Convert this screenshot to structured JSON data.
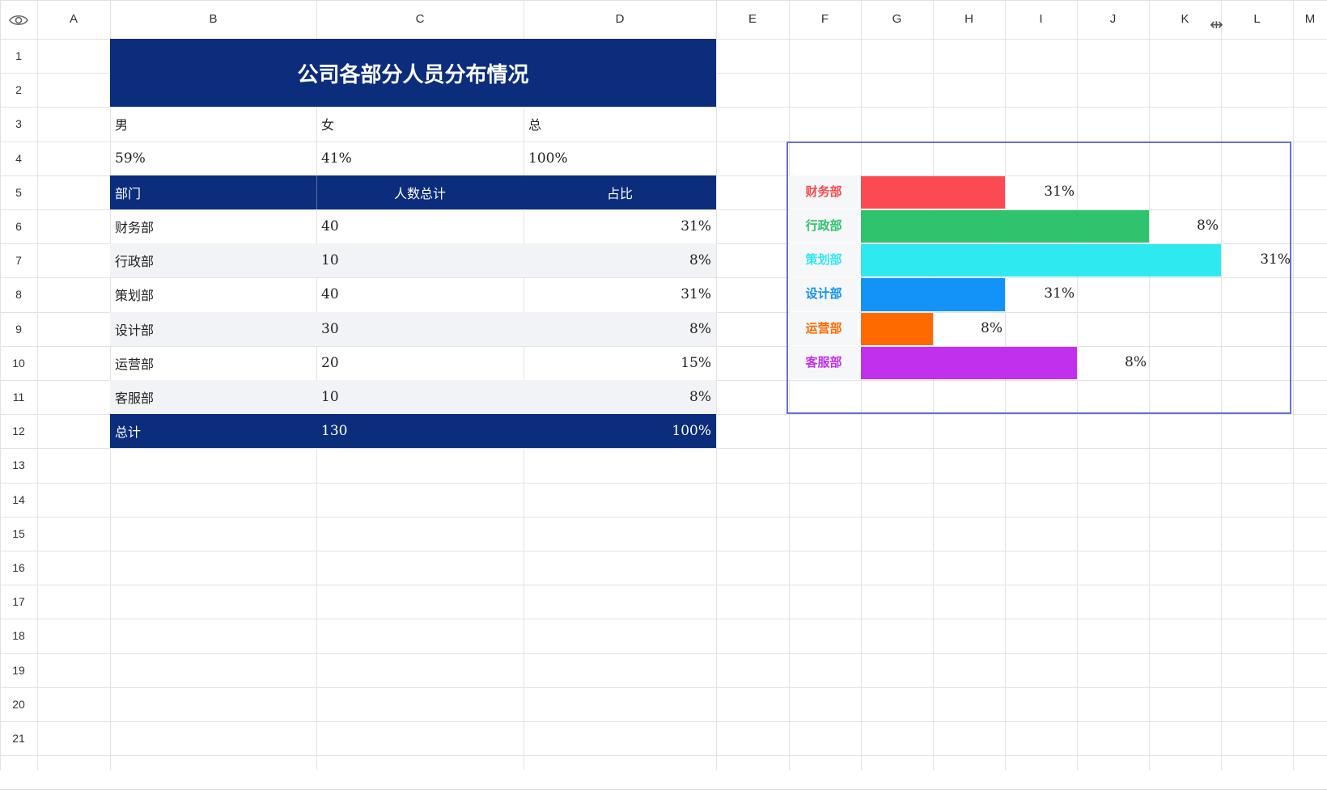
{
  "columns": [
    "A",
    "B",
    "C",
    "D",
    "E",
    "F",
    "G",
    "H",
    "I",
    "J",
    "K",
    "L",
    "M"
  ],
  "rows": [
    "1",
    "2",
    "3",
    "4",
    "5",
    "6",
    "7",
    "8",
    "9",
    "10",
    "11",
    "12",
    "13",
    "14",
    "15",
    "16",
    "17",
    "18",
    "19",
    "20",
    "21"
  ],
  "title": "公司各部分人员分布情况",
  "gender": {
    "labels": [
      "男",
      "女",
      "总"
    ],
    "values": [
      "59%",
      "41%",
      "100%"
    ]
  },
  "table": {
    "headers": [
      "部门",
      "人数总计",
      "占比"
    ],
    "rows": [
      {
        "dept": "财务部",
        "count": "40",
        "pct": "31%"
      },
      {
        "dept": "行政部",
        "count": "10",
        "pct": "8%"
      },
      {
        "dept": "策划部",
        "count": "40",
        "pct": "31%"
      },
      {
        "dept": "设计部",
        "count": "30",
        "pct": "8%"
      },
      {
        "dept": "运营部",
        "count": "20",
        "pct": "15%"
      },
      {
        "dept": "客服部",
        "count": "10",
        "pct": "8%"
      }
    ],
    "total": {
      "label": "总计",
      "count": "130",
      "pct": "100%"
    }
  },
  "chart_data": {
    "type": "bar",
    "orientation": "horizontal",
    "categories": [
      "财务部",
      "行政部",
      "策划部",
      "设计部",
      "运营部",
      "客服部"
    ],
    "values": [
      40,
      80,
      100,
      40,
      20,
      60
    ],
    "value_labels": [
      "31%",
      "8%",
      "31%",
      "31%",
      "8%",
      "8%"
    ],
    "colors": [
      "#fb4a52",
      "#2fc36d",
      "#2eeaf0",
      "#1392f8",
      "#ff6a00",
      "#c130ec"
    ]
  },
  "icons": {
    "view": "eye-icon",
    "cursor": "column-resize-cursor-icon"
  }
}
